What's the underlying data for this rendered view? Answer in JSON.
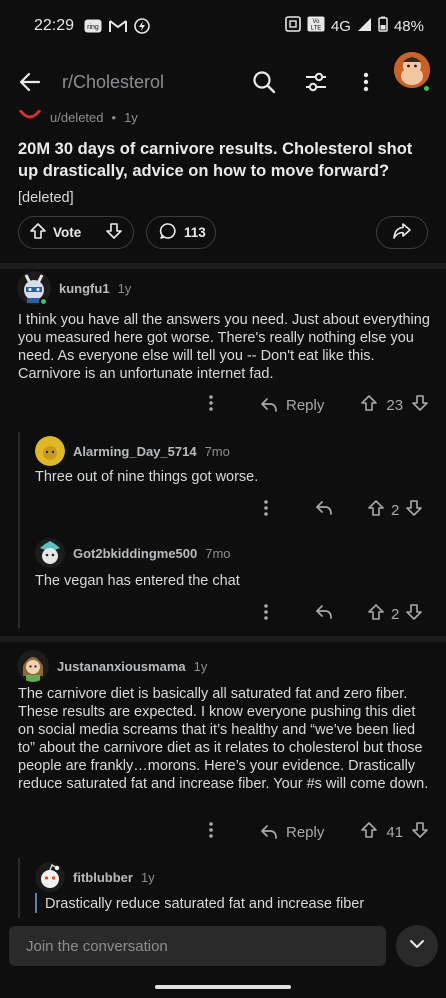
{
  "status_bar": {
    "time": "22:29",
    "icons": [
      "ring-icon",
      "gmail-icon",
      "hotspot-icon"
    ],
    "network": "4G",
    "battery": "48%"
  },
  "header": {
    "subreddit": "r/Cholesterol"
  },
  "post": {
    "author": "u/deleted",
    "age": "1y",
    "title": "20M 30 days of carnivore results. Cholesterol shot up drastically, advice on how to move forward?",
    "body": "[deleted]",
    "vote_label": "Vote",
    "comment_count": "113"
  },
  "comments": [
    {
      "author": "kungfu1",
      "age": "1y",
      "body": "I think you have all the answers you need. Just about everything you measured here got worse. There's really nothing else you need. As everyone else will tell you -- Don't eat like this. Carnivore is an unfortunate internet fad.",
      "reply_label": "Reply",
      "score": "23"
    },
    {
      "author": "Alarming_Day_5714",
      "age": "7mo",
      "body": "Three out of nine things got worse.",
      "score": "2"
    },
    {
      "author": "Got2bkiddingme500",
      "age": "7mo",
      "body": "The vegan has entered the chat",
      "score": "2"
    },
    {
      "author": "Justananxiousmama",
      "age": "1y",
      "body": "The carnivore diet is basically all saturated fat and zero fiber. These results are expected. I know everyone pushing this diet on social media screams that it’s healthy and “we’ve been lied to” about the carnivore diet as it relates to cholesterol but those people are frankly…morons. Here’s your evidence. Drastically reduce saturated fat and increase fiber. Your #s will come down.",
      "reply_label": "Reply",
      "score": "41"
    },
    {
      "author": "fitblubber",
      "age": "1y",
      "body": "Drastically reduce saturated fat and increase fiber"
    }
  ],
  "composer": {
    "placeholder": "Join the conversation"
  },
  "colors": {
    "background": "#0e0e0e",
    "online": "#3fbf5d",
    "quote": "#5a7fb0"
  }
}
